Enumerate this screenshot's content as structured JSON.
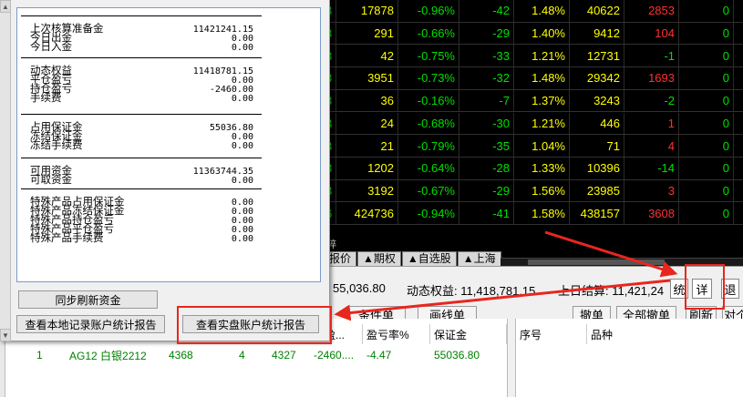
{
  "quote_rows": [
    {
      "frag": "3",
      "vol": "17878",
      "pct": "-0.96%",
      "chg": "-42",
      "rate": "1.48%",
      "oi": "40622",
      "inc": "2853",
      "last": "0",
      "inc_red": true
    },
    {
      "frag": "3",
      "vol": "291",
      "pct": "-0.66%",
      "chg": "-29",
      "rate": "1.40%",
      "oi": "9412",
      "inc": "104",
      "last": "0",
      "inc_red": true
    },
    {
      "frag": "3",
      "vol": "42",
      "pct": "-0.75%",
      "chg": "-33",
      "rate": "1.21%",
      "oi": "12731",
      "inc": "-1",
      "last": "0",
      "inc_red": false
    },
    {
      "frag": "3",
      "vol": "3951",
      "pct": "-0.73%",
      "chg": "-32",
      "rate": "1.48%",
      "oi": "29342",
      "inc": "1693",
      "last": "0",
      "inc_red": true
    },
    {
      "frag": "3",
      "vol": "36",
      "pct": "-0.16%",
      "chg": "-7",
      "rate": "1.37%",
      "oi": "3243",
      "inc": "-2",
      "last": "0",
      "inc_red": false
    },
    {
      "frag": "3",
      "vol": "24",
      "pct": "-0.68%",
      "chg": "-30",
      "rate": "1.21%",
      "oi": "446",
      "inc": "1",
      "last": "0",
      "inc_red": true
    },
    {
      "frag": "3",
      "vol": "21",
      "pct": "-0.79%",
      "chg": "-35",
      "rate": "1.04%",
      "oi": "71",
      "inc": "4",
      "last": "0",
      "inc_red": true
    },
    {
      "frag": "3",
      "vol": "1202",
      "pct": "-0.64%",
      "chg": "-28",
      "rate": "1.33%",
      "oi": "10396",
      "inc": "-14",
      "last": "0",
      "inc_red": false
    },
    {
      "frag": "3",
      "vol": "3192",
      "pct": "-0.67%",
      "chg": "-29",
      "rate": "1.56%",
      "oi": "23985",
      "inc": "3",
      "last": "0",
      "inc_red": true
    },
    {
      "frag": "6",
      "vol": "424736",
      "pct": "-0.94%",
      "chg": "-41",
      "rate": "1.58%",
      "oi": "438157",
      "inc": "3608",
      "last": "0",
      "inc_red": true
    }
  ],
  "tabs": {
    "above_text": "碎",
    "items": [
      "报价",
      "▲期权",
      "▲自选股",
      "▲上海"
    ]
  },
  "status": {
    "margin_text": "55,036.80",
    "equity_text": "动态权益: 11,418,781.15",
    "settle_text": "上日结算: 11,421,24",
    "btn_tong": "统",
    "btn_xiang": "详",
    "btn_tui": "退"
  },
  "toolbar": {
    "cond_order": "条件单",
    "draw_line": "画线单",
    "cancel": "撤单",
    "cancel_all": "全部撤单",
    "refresh": "刷新",
    "pair": "对个"
  },
  "position_grid": {
    "headers": [
      "浮盈...",
      "盈亏率%",
      "保证金"
    ],
    "row": {
      "idx": "1",
      "contract": "AG12 白银2212",
      "c3": "4368",
      "c4": "4",
      "c5": "4327",
      "pl": "-2460....",
      "plr": "-4.47",
      "margin": "55036.80"
    }
  },
  "order_grid": {
    "headers": [
      "序号",
      "品种"
    ]
  },
  "fund_panel": {
    "sections": [
      [
        {
          "label": "上次核算准备金",
          "value": "11421241.15"
        },
        {
          "label": "今日出金",
          "value": "0.00"
        },
        {
          "label": "今日入金",
          "value": "0.00"
        }
      ],
      [
        {
          "label": "动态权益",
          "value": "11418781.15"
        },
        {
          "label": "平仓盈亏",
          "value": "0.00"
        },
        {
          "label": "持仓盈亏",
          "value": "-2460.00"
        },
        {
          "label": "手续费",
          "value": "0.00"
        }
      ],
      [
        {
          "label": "占用保证金",
          "value": "55036.80"
        },
        {
          "label": "冻结保证金",
          "value": "0.00"
        },
        {
          "label": "冻结手续费",
          "value": "0.00"
        }
      ],
      [
        {
          "label": "可用资金",
          "value": "11363744.35"
        },
        {
          "label": "可取资金",
          "value": "0.00"
        }
      ],
      [
        {
          "label": "特殊产品占用保证金",
          "value": "0.00"
        },
        {
          "label": "特殊产品冻结保证金",
          "value": "0.00"
        },
        {
          "label": "特殊产品持仓盈亏",
          "value": "0.00"
        },
        {
          "label": "特殊产品平仓盈亏",
          "value": "0.00"
        },
        {
          "label": "特殊产品手续费",
          "value": "0.00"
        }
      ]
    ],
    "sync_button": "同步刷新资金",
    "local_report_button": "查看本地记录账户统计报告",
    "real_report_button": "查看实盘账户统计报告"
  },
  "colors": {
    "annotation": "#e8261e",
    "price_up": "#ff3030",
    "price_down": "#00e000",
    "volume": "#ffff00"
  }
}
